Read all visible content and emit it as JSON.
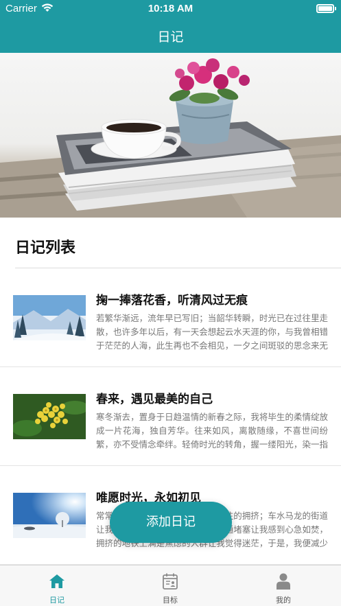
{
  "status_bar": {
    "carrier": "Carrier",
    "time": "10:18 AM"
  },
  "nav": {
    "title": "日记"
  },
  "section": {
    "title": "日记列表"
  },
  "diaries": [
    {
      "title": "掬一捧落花香，听清风过无痕",
      "body": "若繁华渐远，流年早已写旧；当韶华转瞬，时光已在过往里走散，也许多年以后，有一天会想起云水天涯的你，与我曾相错于茫茫的人海，此生再也不会相见，一夕之间斑驳的思念来无声息的身影，久久的…",
      "image": "snowy-forest"
    },
    {
      "title": "春来，遇见最美的自己",
      "body": "寒冬渐去，置身于日趋温情的新春之际，我将毕生的柔情绽放成一片花海，独自芳华。往来如风，离散随缘，不喜世间纷繁，亦不受情念牵绊。轻倚时光的转角，握一缕阳光，染一指花香，盛露煮茶，静看时…",
      "image": "yellow-flowers"
    },
    {
      "title": "唯愿时光，永如初见",
      "body": "常常觉得城市太过于喧嚣，人来人往的拥挤；车水马龙的街道让我找不到宁静的方向，拥挤的交通堵塞让我感到心急如焚，拥挤的地铁上满是焦虑的人群让我觉得迷茫，于是，我便减少了出门，减少了拥挤，只想一个人，清清静…",
      "image": "winter-sun"
    }
  ],
  "fab": {
    "label": "添加日记"
  },
  "tabs": [
    {
      "label": "日记",
      "icon": "home-icon",
      "active": true
    },
    {
      "label": "目标",
      "icon": "calendar-icon",
      "active": false
    },
    {
      "label": "我的",
      "icon": "person-icon",
      "active": false
    }
  ],
  "colors": {
    "accent": "#1e9aa2",
    "tab_inactive": "#8a8a8a"
  }
}
